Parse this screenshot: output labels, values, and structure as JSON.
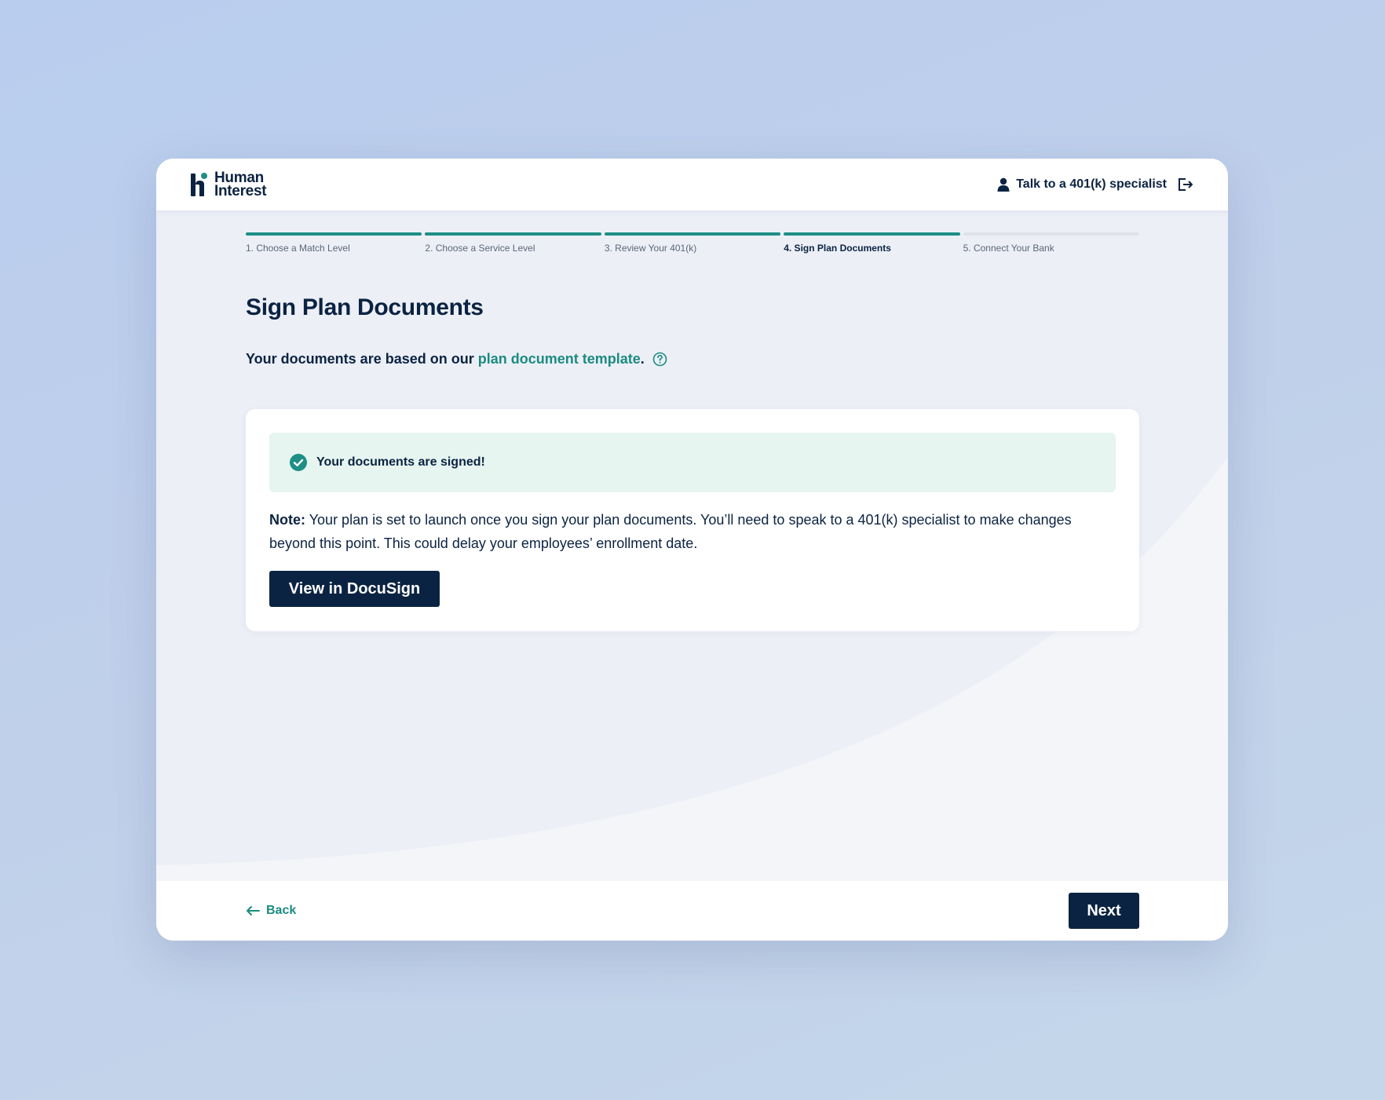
{
  "brand": {
    "line1": "Human",
    "line2": "Interest",
    "accent_color": "#1d8f85",
    "navy_color": "#0b2342"
  },
  "header": {
    "specialist_label": "Talk to a 401(k) specialist",
    "user_icon": "person-icon",
    "exit_icon": "logout-icon"
  },
  "stepper": {
    "steps": [
      {
        "label": "1. Choose a Match Level",
        "state": "done"
      },
      {
        "label": "2. Choose a Service Level",
        "state": "done"
      },
      {
        "label": "3. Review Your 401(k)",
        "state": "done"
      },
      {
        "label": "4. Sign Plan Documents",
        "state": "active"
      },
      {
        "label": "5. Connect Your Bank",
        "state": "todo"
      }
    ]
  },
  "main": {
    "title": "Sign Plan Documents",
    "intro_prefix": "Your documents are based on our",
    "intro_link": "plan document template",
    "intro_suffix": ".",
    "help_icon": "question-circle-icon"
  },
  "card": {
    "success_icon": "check-circle-icon",
    "success_message": "Your documents are signed!",
    "note_label": "Note:",
    "note_text": "Your plan is set to launch once you sign your plan documents. You’ll need to speak to a 401(k) specialist to make changes beyond this point. This could delay your employees’ enrollment date.",
    "docusign_button": "View in DocuSign"
  },
  "footer": {
    "back_label": "Back",
    "back_icon": "arrow-left-icon",
    "next_label": "Next"
  }
}
